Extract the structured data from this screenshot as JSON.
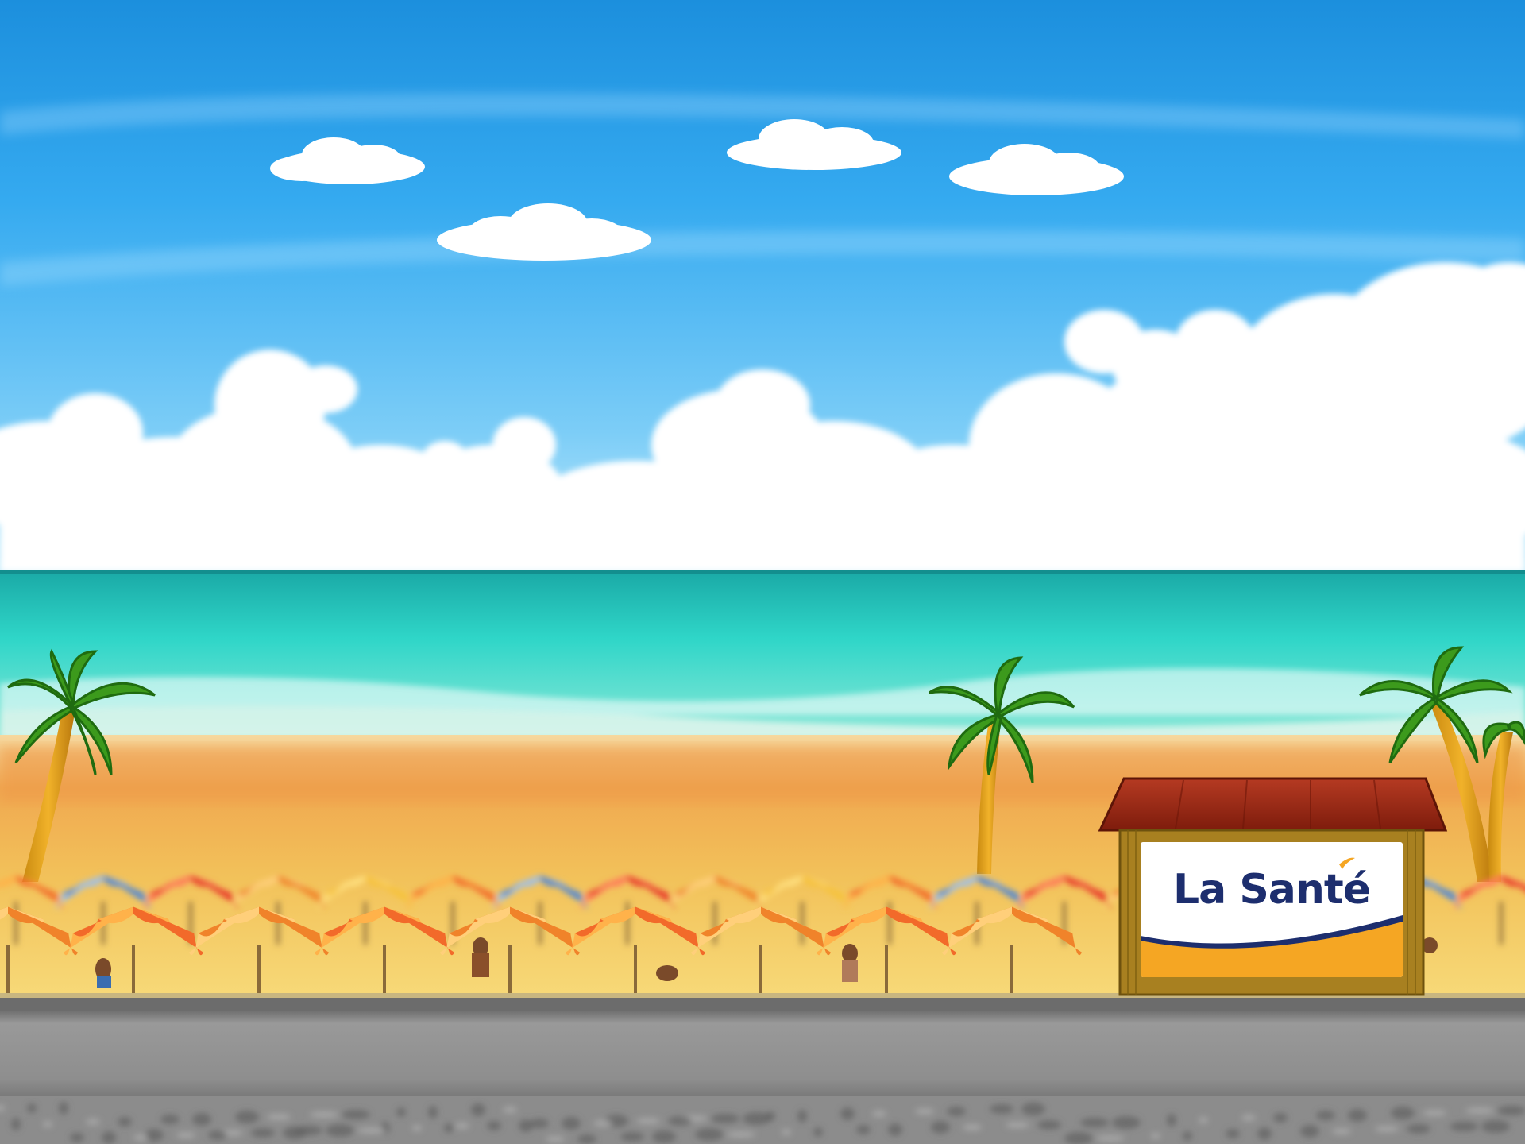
{
  "scene": {
    "type": "side-scrolling game background",
    "setting": "beach"
  },
  "kiosk": {
    "sign_text": "La Santé"
  },
  "colors": {
    "sky_top": "#1c8fdd",
    "sky_bottom": "#bfe9fb",
    "sea": "#2cd0c4",
    "sand": "#f2c25a",
    "road": "#8a8a8a",
    "roof": "#9b2512",
    "kiosk_wood": "#b48a1e",
    "brand_navy": "#1d2e6e",
    "brand_orange": "#f5a623"
  },
  "icons": [
    "cloud-icon",
    "palm-tree-icon",
    "beach-umbrella-icon",
    "kiosk-icon"
  ]
}
